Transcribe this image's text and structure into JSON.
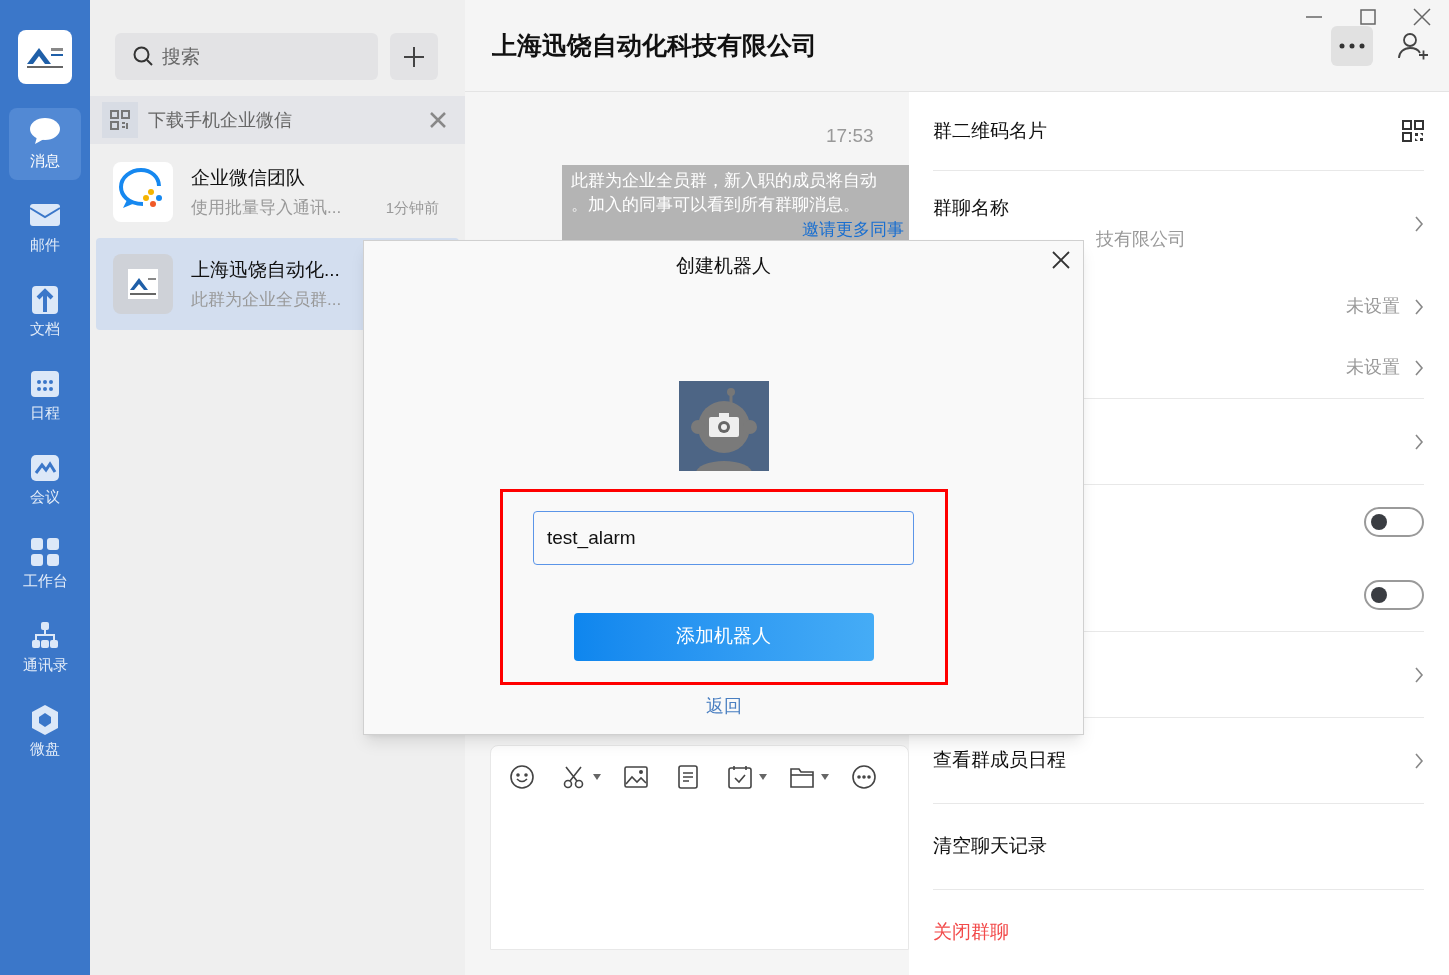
{
  "nav": [
    {
      "label": "消息",
      "selected": true
    },
    {
      "label": "邮件",
      "selected": false
    },
    {
      "label": "文档",
      "selected": false
    },
    {
      "label": "日程",
      "selected": false
    },
    {
      "label": "会议",
      "selected": false
    },
    {
      "label": "工作台",
      "selected": false
    },
    {
      "label": "通讯录",
      "selected": false
    },
    {
      "label": "微盘",
      "selected": false
    }
  ],
  "search": {
    "placeholder": "搜索"
  },
  "download_banner": {
    "text": "下载手机企业微信"
  },
  "chats": [
    {
      "name": "企业微信团队",
      "preview": "使用批量导入通讯...",
      "time": "1分钟前",
      "selected": false
    },
    {
      "name": "上海迅饶自动化...",
      "preview": "此群为企业全员群...",
      "selected": true
    }
  ],
  "header": {
    "title": "上海迅饶自动化科技有限公司"
  },
  "messages": {
    "time": "17:53",
    "notice_lines": [
      "此群为企业全员群，新入职的成员将自动",
      "。加入的同事可以看到所有群聊消息。"
    ],
    "link": "邀请更多同事"
  },
  "composer_tools": [
    {
      "dropdown": false
    },
    {
      "dropdown": true
    },
    {
      "dropdown": false
    },
    {
      "dropdown": false
    },
    {
      "dropdown": true
    },
    {
      "dropdown": true
    },
    {
      "dropdown": false
    }
  ],
  "settings": [
    [
      {
        "kind": "qr",
        "label": "群二维码名片"
      }
    ],
    [
      {
        "kind": "nav",
        "label": "群聊名称",
        "value": "技有限公司"
      },
      {
        "kind": "nav",
        "value": "未设置"
      },
      {
        "kind": "nav",
        "value": "未设置"
      }
    ],
    [
      {
        "kind": "nav"
      }
    ],
    [
      {
        "kind": "toggle",
        "on": false
      },
      {
        "kind": "toggle",
        "on": false
      }
    ],
    [
      {
        "kind": "nav"
      }
    ],
    [
      {
        "kind": "nav",
        "label": "查看群成员日程"
      }
    ],
    [
      {
        "kind": "plain",
        "label": "清空聊天记录"
      }
    ],
    [
      {
        "kind": "danger",
        "label": "关闭群聊"
      }
    ]
  ],
  "dialog": {
    "title": "创建机器人",
    "name_value": "test_alarm",
    "button": "添加机器人",
    "back": "返回"
  }
}
